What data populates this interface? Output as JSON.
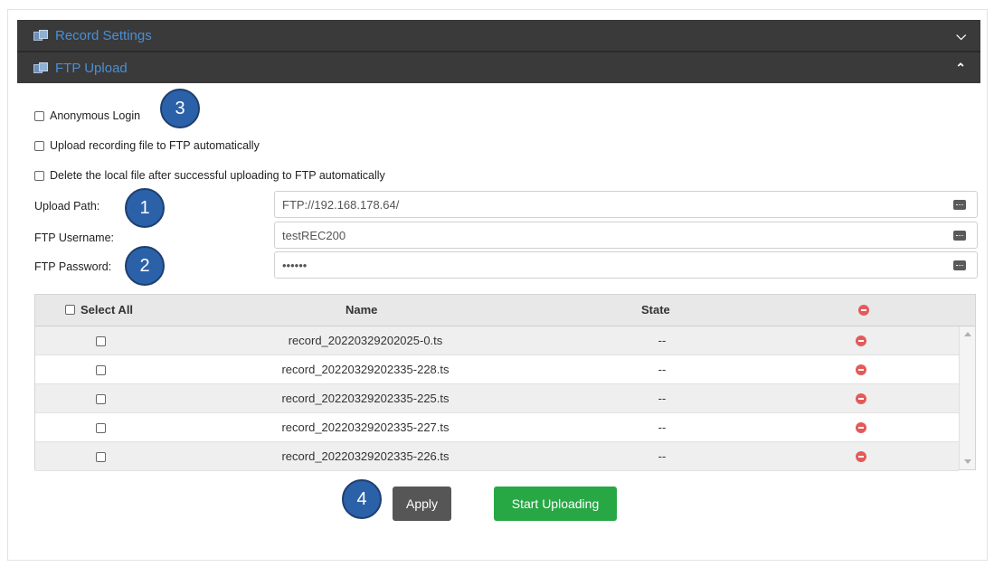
{
  "panels": {
    "record_settings": {
      "title": "Record Settings",
      "chevron": "chevron-down-icon"
    },
    "ftp_upload": {
      "title": "FTP Upload",
      "chevron": "chevron-up-icon"
    }
  },
  "options": {
    "anonymous_login": "Anonymous Login",
    "auto_upload": "Upload recording file to FTP automatically",
    "delete_local": "Delete the local file after successful uploading to FTP automatically"
  },
  "fields": {
    "upload_path": {
      "label": "Upload Path:",
      "value": "FTP://192.168.178.64/"
    },
    "username": {
      "label": "FTP Username:",
      "value": "testREC200"
    },
    "password": {
      "label": "FTP Password:",
      "value": "••••••"
    }
  },
  "callouts": {
    "c1": "1",
    "c2": "2",
    "c3": "3",
    "c4": "4"
  },
  "table": {
    "headers": {
      "select_all": "Select All",
      "name": "Name",
      "state": "State"
    },
    "rows": [
      {
        "name": "record_20220329202025-0.ts",
        "state": "--"
      },
      {
        "name": "record_20220329202335-228.ts",
        "state": "--"
      },
      {
        "name": "record_20220329202335-225.ts",
        "state": "--"
      },
      {
        "name": "record_20220329202335-227.ts",
        "state": "--"
      },
      {
        "name": "record_20220329202335-226.ts",
        "state": "--"
      }
    ]
  },
  "buttons": {
    "apply": "Apply",
    "start_uploading": "Start Uploading"
  },
  "colors": {
    "header_bg": "#3a3a3a",
    "header_text": "#4a8fd6",
    "callout": "#2b61a8",
    "apply": "#565656",
    "upload": "#28a745",
    "delete": "#e45a5a"
  }
}
